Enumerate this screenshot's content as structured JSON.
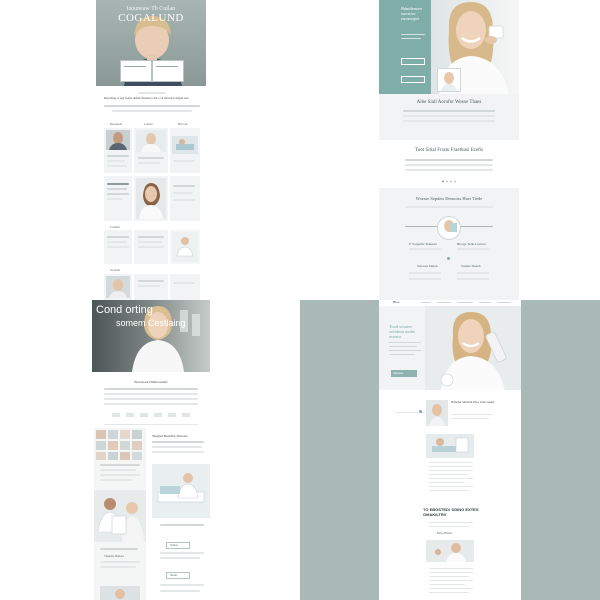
{
  "q1": {
    "hero_title_small": "Isuuneaw Th Cuilan",
    "hero_title": "COGALUND",
    "intro_heading": "Descaling of sug bonne duferis Dentarra arif a cli bruicatal dtegad and",
    "card_labels": [
      "Reassenal",
      "Conent",
      "Brscons",
      "Coulind",
      "Soratain"
    ]
  },
  "q2": {
    "hero_title": "Bdatdeazen naestive eansnapet",
    "band_title": "Aibe Siail Aorufor Wesne Thaes",
    "section2_title": "Tuot Sitial Frsstu Fraethusi Ezefis",
    "section3_title": "Wseare Sepdetr Drenoiss Haer Tiede",
    "col_labels": [
      "E Sorpertlr Telenser",
      "Blorge Tede Louvrer"
    ],
    "col_labels_2": [
      "Seroaur Sialen",
      "Srenne Sisseh"
    ]
  },
  "q3": {
    "hero_line1": "Cond orting",
    "hero_line2": "somem Cestlaing",
    "section_title": "Brestavek Dimnaosetfir",
    "right_heading": "Sfugdal Buntfior Stursere",
    "buttons": [
      "Thensile Buttaro",
      "Sabrse",
      "Stenu"
    ]
  },
  "q4": {
    "nav_brand": "Bloe",
    "hero_title": "Tood sroutee sofidesu niohe aseutw",
    "cta_label": "Sidesuer",
    "news_title": "Blatedur Sdnlerin Tilea lonte Gauter",
    "headline": "TO EBOSTED! SGING EXTES GMAKILTRV",
    "section_small": "Blaoe Bnaiee"
  },
  "colors": {
    "sage_dark": "#8b9a97",
    "sage_panel": "#a9b9b5",
    "teal_panel": "#7fadaa",
    "light_panel": "#f1f3f4",
    "text_gray": "#55666a"
  }
}
